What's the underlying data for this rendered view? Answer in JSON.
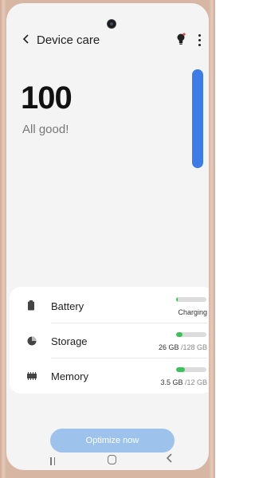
{
  "appbar": {
    "title": "Device care",
    "back_icon": "chevron-left-icon",
    "tip_icon": "lightbulb-icon",
    "more_icon": "more-vertical-icon"
  },
  "score": {
    "value": "100",
    "status": "All good!"
  },
  "items": [
    {
      "label": "Battery",
      "icon": "battery-icon",
      "level": 0.03,
      "value_used": "Charging",
      "value_total": ""
    },
    {
      "label": "Storage",
      "icon": "storage-pie-icon",
      "level": 0.2,
      "value_used": "26 GB",
      "value_total": " /128 GB"
    },
    {
      "label": "Memory",
      "icon": "memory-chip-icon",
      "level": 0.3,
      "value_used": "3.5 GB",
      "value_total": " /12 GB"
    }
  ],
  "actions": {
    "optimize_label": "Optimize now"
  },
  "navbar": {
    "recents_icon": "recents-icon",
    "home_icon": "home-icon",
    "back_icon": "back-icon"
  },
  "colors": {
    "accent": "#3d7be6",
    "bar_fill": "#3ec15a",
    "button": "#9dc3ec"
  }
}
